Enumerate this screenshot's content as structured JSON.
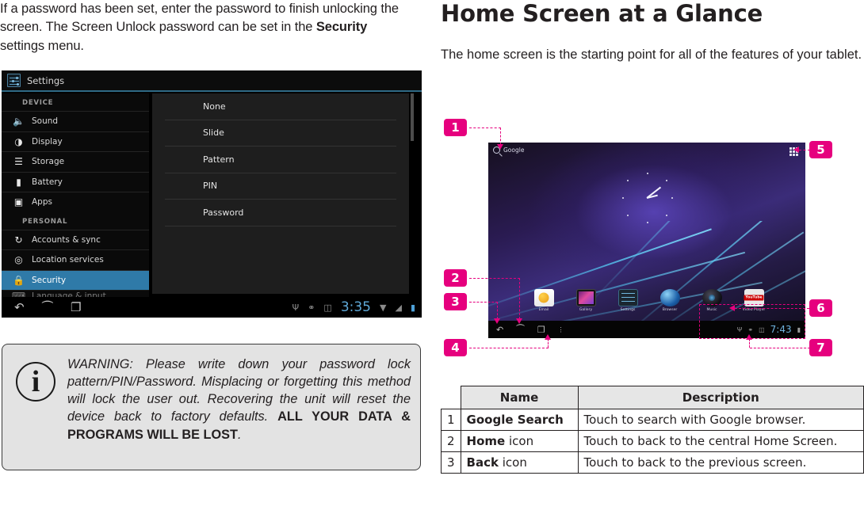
{
  "left_column": {
    "intro_paragraph_parts": [
      "If a password has been set, enter the password to finish unlocking the screen. The Screen Unlock password can be set in the ",
      "Security",
      " settings menu."
    ],
    "settings_screenshot": {
      "app_title": "Settings",
      "app_icon": "settings-sliders-icon",
      "sections": [
        {
          "label": "DEVICE",
          "items": [
            {
              "label": "Sound",
              "icon": "sound-icon",
              "selected": false
            },
            {
              "label": "Display",
              "icon": "display-icon",
              "selected": false
            },
            {
              "label": "Storage",
              "icon": "storage-icon",
              "selected": false
            },
            {
              "label": "Battery",
              "icon": "battery-icon",
              "selected": false
            },
            {
              "label": "Apps",
              "icon": "apps-icon",
              "selected": false
            }
          ]
        },
        {
          "label": "PERSONAL",
          "items": [
            {
              "label": "Accounts & sync",
              "icon": "sync-icon",
              "selected": false
            },
            {
              "label": "Location services",
              "icon": "location-icon",
              "selected": false
            },
            {
              "label": "Security",
              "icon": "lock-icon",
              "selected": true
            },
            {
              "label": "Language & input",
              "icon": "keyboard-icon",
              "selected": false
            }
          ]
        }
      ],
      "lock_options": [
        "None",
        "Slide",
        "Pattern",
        "PIN",
        "Password"
      ],
      "status_bar": {
        "time": "3:35",
        "icons": [
          "usb-icon",
          "android-icon",
          "sdcard-icon",
          "wifi-icon",
          "signal-icon",
          "battery-icon"
        ],
        "nav_icons": [
          "back-icon",
          "home-icon",
          "recents-icon"
        ]
      }
    },
    "warning": {
      "icon": "info-icon",
      "glyph": "i",
      "text_parts": [
        "WARNING: Please write down your password lock pattern/PIN/Password. Misplacing or forgetting this method will lock the user out. Recovering the unit will reset the device back to factory defaults. ",
        "ALL YOUR DATA & PROGRAMS WILL BE LOST",
        "."
      ]
    }
  },
  "right_column": {
    "heading": "Home Screen at a Glance",
    "subheading": "The home screen is the starting point for all of the features of your tablet.",
    "figure": {
      "callouts": [
        "1",
        "2",
        "3",
        "4",
        "5",
        "6",
        "7"
      ],
      "accent_color": "#e6007e",
      "tablet": {
        "search_label": "Google",
        "search_icon": "magnifier-icon",
        "apps_grid_icon": "all-apps-icon",
        "dock_apps": [
          {
            "label": "Email",
            "icon": "email-icon"
          },
          {
            "label": "Gallery",
            "icon": "gallery-icon"
          },
          {
            "label": "Settings",
            "icon": "settings-icon"
          },
          {
            "label": "Browser",
            "icon": "browser-icon"
          },
          {
            "label": "Music",
            "icon": "music-icon"
          },
          {
            "label": "Video Player",
            "icon": "youtube-icon"
          }
        ],
        "nav_icons": [
          "back-icon",
          "home-icon",
          "recents-icon",
          "menu-icon"
        ],
        "status_time": "7:43",
        "status_icons": [
          "usb-icon",
          "android-icon",
          "sdcard-icon",
          "battery-icon"
        ]
      }
    },
    "table": {
      "headers": [
        "",
        "Name",
        "Description"
      ],
      "rows": [
        {
          "num": "1",
          "name_bold": "Google Search",
          "name_rest": "",
          "description": "Touch to search with Google browser."
        },
        {
          "num": "2",
          "name_bold": "Home",
          "name_rest": " icon",
          "description": "Touch to back to the central Home Screen."
        },
        {
          "num": "3",
          "name_bold": "Back",
          "name_rest": " icon",
          "description": "Touch to back to the previous screen."
        }
      ]
    }
  }
}
